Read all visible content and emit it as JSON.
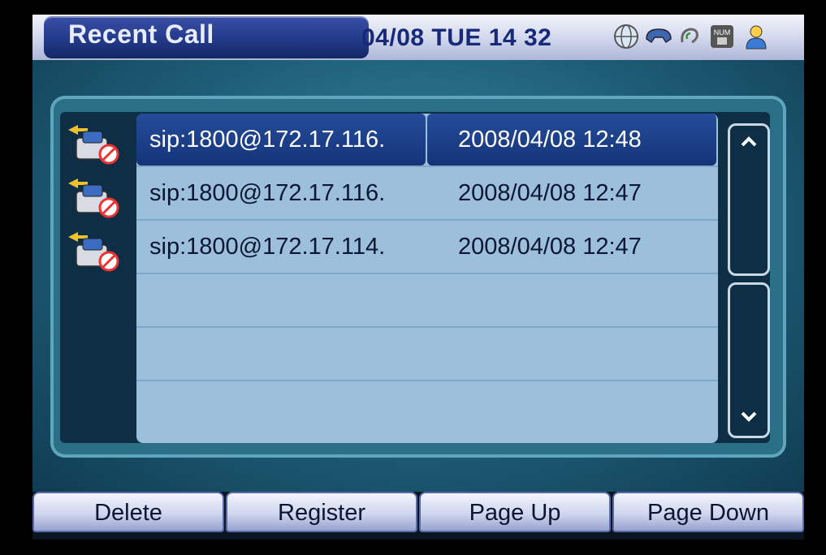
{
  "header": {
    "title": "Recent Call",
    "datetime": "04/08 TUE 14 32"
  },
  "status_icons": [
    "network-globe-icon",
    "phone-handset-icon",
    "hearing-volume-icon",
    "num-keypad-icon",
    "user-icon"
  ],
  "calls": [
    {
      "address": "sip:1800@172.17.116.",
      "time": "2008/04/08  12:48",
      "selected": true,
      "icon": "missed-call-icon"
    },
    {
      "address": "sip:1800@172.17.116.",
      "time": "2008/04/08  12:47",
      "selected": false,
      "icon": "missed-call-icon"
    },
    {
      "address": "sip:1800@172.17.114.",
      "time": "2008/04/08  12:47",
      "selected": false,
      "icon": "missed-call-icon"
    }
  ],
  "softkeys": {
    "delete": "Delete",
    "register": "Register",
    "page_up": "Page Up",
    "page_down": "Page Down"
  },
  "num_badge": "NUM"
}
